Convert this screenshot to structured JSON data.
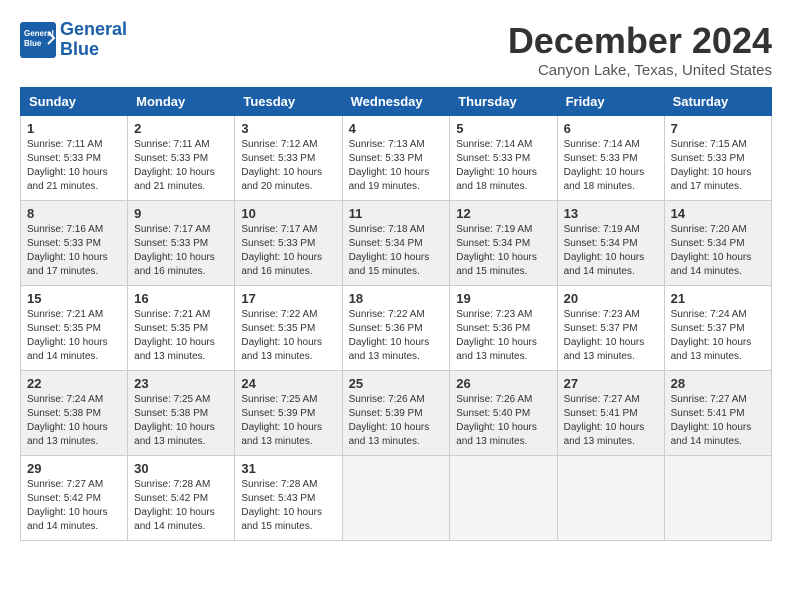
{
  "header": {
    "logo_line1": "General",
    "logo_line2": "Blue",
    "title": "December 2024",
    "subtitle": "Canyon Lake, Texas, United States"
  },
  "days_of_week": [
    "Sunday",
    "Monday",
    "Tuesday",
    "Wednesday",
    "Thursday",
    "Friday",
    "Saturday"
  ],
  "weeks": [
    [
      {
        "day": "1",
        "info": "Sunrise: 7:11 AM\nSunset: 5:33 PM\nDaylight: 10 hours\nand 21 minutes."
      },
      {
        "day": "2",
        "info": "Sunrise: 7:11 AM\nSunset: 5:33 PM\nDaylight: 10 hours\nand 21 minutes."
      },
      {
        "day": "3",
        "info": "Sunrise: 7:12 AM\nSunset: 5:33 PM\nDaylight: 10 hours\nand 20 minutes."
      },
      {
        "day": "4",
        "info": "Sunrise: 7:13 AM\nSunset: 5:33 PM\nDaylight: 10 hours\nand 19 minutes."
      },
      {
        "day": "5",
        "info": "Sunrise: 7:14 AM\nSunset: 5:33 PM\nDaylight: 10 hours\nand 18 minutes."
      },
      {
        "day": "6",
        "info": "Sunrise: 7:14 AM\nSunset: 5:33 PM\nDaylight: 10 hours\nand 18 minutes."
      },
      {
        "day": "7",
        "info": "Sunrise: 7:15 AM\nSunset: 5:33 PM\nDaylight: 10 hours\nand 17 minutes."
      }
    ],
    [
      {
        "day": "8",
        "info": "Sunrise: 7:16 AM\nSunset: 5:33 PM\nDaylight: 10 hours\nand 17 minutes."
      },
      {
        "day": "9",
        "info": "Sunrise: 7:17 AM\nSunset: 5:33 PM\nDaylight: 10 hours\nand 16 minutes."
      },
      {
        "day": "10",
        "info": "Sunrise: 7:17 AM\nSunset: 5:33 PM\nDaylight: 10 hours\nand 16 minutes."
      },
      {
        "day": "11",
        "info": "Sunrise: 7:18 AM\nSunset: 5:34 PM\nDaylight: 10 hours\nand 15 minutes."
      },
      {
        "day": "12",
        "info": "Sunrise: 7:19 AM\nSunset: 5:34 PM\nDaylight: 10 hours\nand 15 minutes."
      },
      {
        "day": "13",
        "info": "Sunrise: 7:19 AM\nSunset: 5:34 PM\nDaylight: 10 hours\nand 14 minutes."
      },
      {
        "day": "14",
        "info": "Sunrise: 7:20 AM\nSunset: 5:34 PM\nDaylight: 10 hours\nand 14 minutes."
      }
    ],
    [
      {
        "day": "15",
        "info": "Sunrise: 7:21 AM\nSunset: 5:35 PM\nDaylight: 10 hours\nand 14 minutes."
      },
      {
        "day": "16",
        "info": "Sunrise: 7:21 AM\nSunset: 5:35 PM\nDaylight: 10 hours\nand 13 minutes."
      },
      {
        "day": "17",
        "info": "Sunrise: 7:22 AM\nSunset: 5:35 PM\nDaylight: 10 hours\nand 13 minutes."
      },
      {
        "day": "18",
        "info": "Sunrise: 7:22 AM\nSunset: 5:36 PM\nDaylight: 10 hours\nand 13 minutes."
      },
      {
        "day": "19",
        "info": "Sunrise: 7:23 AM\nSunset: 5:36 PM\nDaylight: 10 hours\nand 13 minutes."
      },
      {
        "day": "20",
        "info": "Sunrise: 7:23 AM\nSunset: 5:37 PM\nDaylight: 10 hours\nand 13 minutes."
      },
      {
        "day": "21",
        "info": "Sunrise: 7:24 AM\nSunset: 5:37 PM\nDaylight: 10 hours\nand 13 minutes."
      }
    ],
    [
      {
        "day": "22",
        "info": "Sunrise: 7:24 AM\nSunset: 5:38 PM\nDaylight: 10 hours\nand 13 minutes."
      },
      {
        "day": "23",
        "info": "Sunrise: 7:25 AM\nSunset: 5:38 PM\nDaylight: 10 hours\nand 13 minutes."
      },
      {
        "day": "24",
        "info": "Sunrise: 7:25 AM\nSunset: 5:39 PM\nDaylight: 10 hours\nand 13 minutes."
      },
      {
        "day": "25",
        "info": "Sunrise: 7:26 AM\nSunset: 5:39 PM\nDaylight: 10 hours\nand 13 minutes."
      },
      {
        "day": "26",
        "info": "Sunrise: 7:26 AM\nSunset: 5:40 PM\nDaylight: 10 hours\nand 13 minutes."
      },
      {
        "day": "27",
        "info": "Sunrise: 7:27 AM\nSunset: 5:41 PM\nDaylight: 10 hours\nand 13 minutes."
      },
      {
        "day": "28",
        "info": "Sunrise: 7:27 AM\nSunset: 5:41 PM\nDaylight: 10 hours\nand 14 minutes."
      }
    ],
    [
      {
        "day": "29",
        "info": "Sunrise: 7:27 AM\nSunset: 5:42 PM\nDaylight: 10 hours\nand 14 minutes."
      },
      {
        "day": "30",
        "info": "Sunrise: 7:28 AM\nSunset: 5:42 PM\nDaylight: 10 hours\nand 14 minutes."
      },
      {
        "day": "31",
        "info": "Sunrise: 7:28 AM\nSunset: 5:43 PM\nDaylight: 10 hours\nand 15 minutes."
      },
      null,
      null,
      null,
      null
    ]
  ]
}
